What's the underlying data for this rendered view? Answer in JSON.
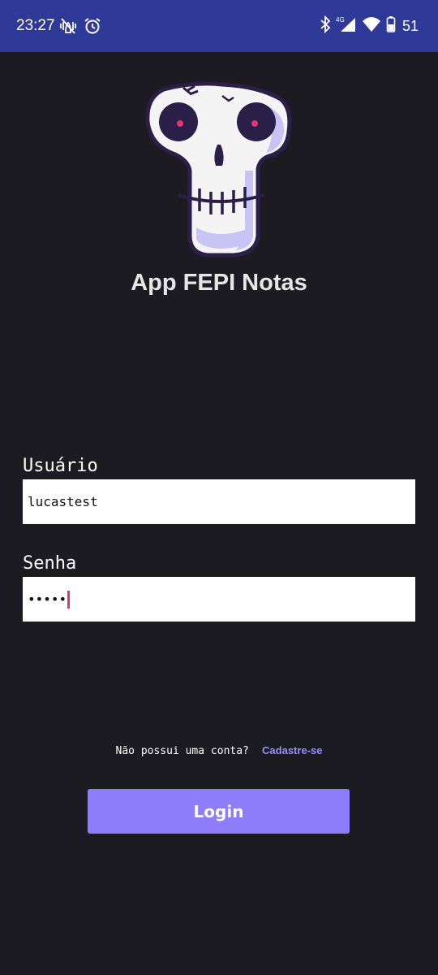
{
  "status_bar": {
    "time": "23:27",
    "network": "4G",
    "battery": "51",
    "icons": [
      "vibrate-off-icon",
      "alarm-icon",
      "bluetooth-icon",
      "signal-icon",
      "wifi-icon",
      "battery-icon"
    ]
  },
  "header": {
    "logo": "skull-logo",
    "title": "App FEPI Notas"
  },
  "form": {
    "username_label": "Usuário",
    "username_value": "lucastest",
    "password_label": "Senha",
    "password_value": "•••••"
  },
  "signup": {
    "prompt": "Não possui uma conta?",
    "link": "Cadastre-se"
  },
  "login_button": "Login",
  "colors": {
    "background": "#1c1b22",
    "status_bar": "#2f3a98",
    "accent": "#8e7cf9",
    "link": "#9c8cff",
    "cursor": "#e2336f"
  }
}
